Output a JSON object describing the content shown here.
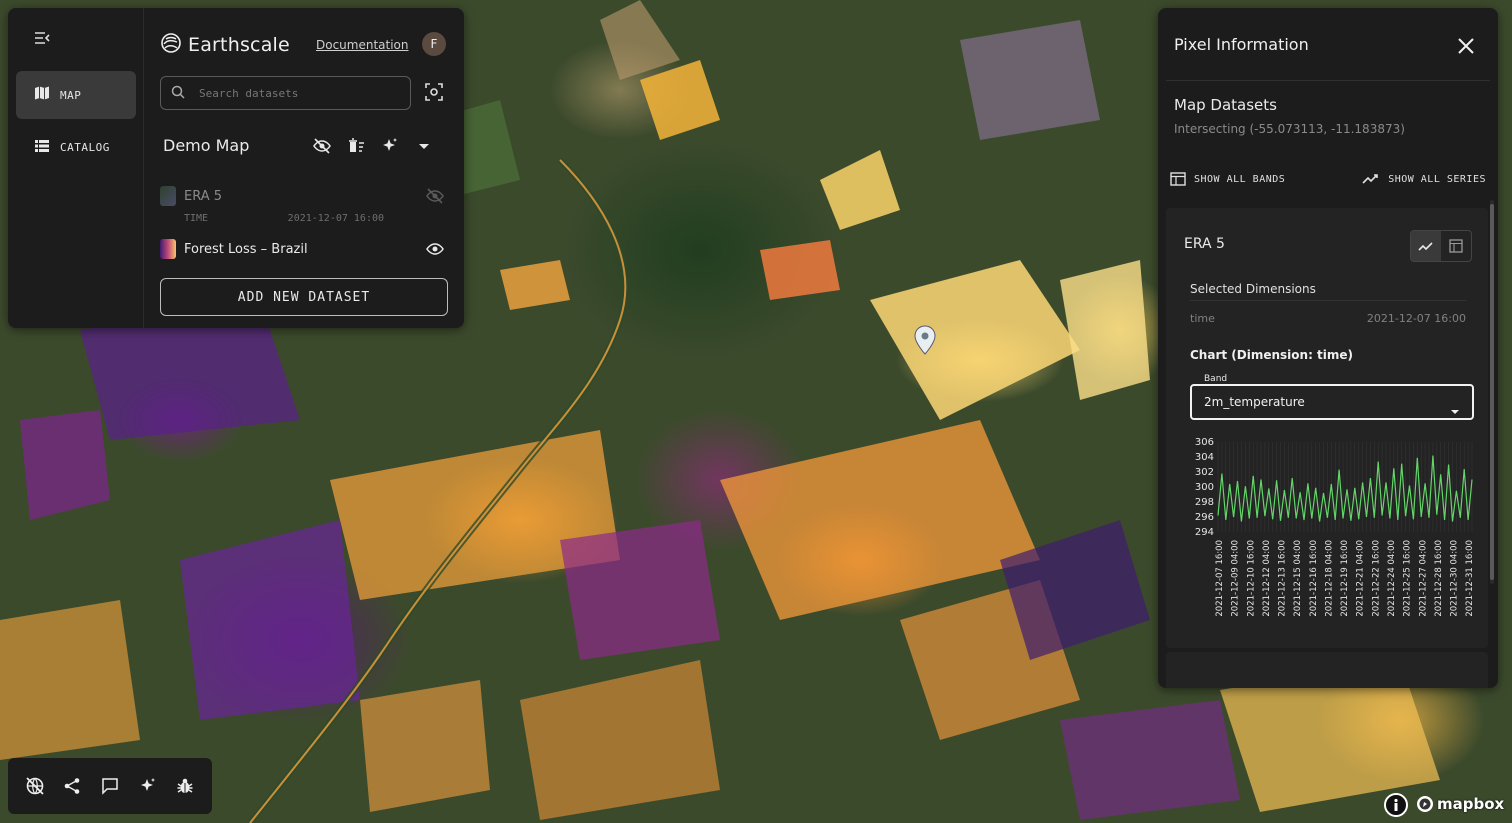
{
  "app": {
    "brand_name": "Earthscale",
    "documentation_link": "Documentation",
    "user_initial": "F"
  },
  "rail": {
    "items": [
      {
        "label": "MAP",
        "icon": "map-icon",
        "active": true
      },
      {
        "label": "CATALOG",
        "icon": "list-icon",
        "active": false
      }
    ]
  },
  "search": {
    "placeholder": "Search datasets"
  },
  "map_panel": {
    "title": "Demo Map",
    "layers": [
      {
        "name": "ERA 5",
        "visible": false,
        "dimension_label": "TIME",
        "dimension_value": "2021-12-07 16:00"
      },
      {
        "name": "Forest Loss – Brazil",
        "visible": true
      }
    ],
    "add_button": "ADD NEW DATASET"
  },
  "pixel_panel": {
    "title": "Pixel Information",
    "section_title": "Map Datasets",
    "intersecting": "Intersecting (-55.073113, -11.183873)",
    "show_all_bands": "SHOW ALL BANDS",
    "show_all_series": "SHOW ALL SERIES",
    "dataset": {
      "name": "ERA 5",
      "selected_dimensions_title": "Selected Dimensions",
      "dimension_name": "time",
      "dimension_value": "2021-12-07 16:00",
      "chart_title": "Chart (Dimension: time)",
      "band_label": "Band",
      "band_value": "2m_temperature"
    }
  },
  "colors": {
    "panel_bg": "#1c1c1c",
    "line_series": "#63d66a",
    "accent_text": "#eaeaea"
  },
  "chart_data": {
    "type": "line",
    "title": "",
    "xlabel": "",
    "ylabel": "",
    "ylim": [
      294,
      306
    ],
    "yticks": [
      "306",
      "304",
      "302",
      "300",
      "298",
      "296",
      "294"
    ],
    "xtick_labels": [
      "2021-12-07 16:00",
      "2021-12-09 04:00",
      "2021-12-10 16:00",
      "2021-12-12 04:00",
      "2021-12-13 16:00",
      "2021-12-15 04:00",
      "2021-12-16 16:00",
      "2021-12-18 04:00",
      "2021-12-19 16:00",
      "2021-12-21 04:00",
      "2021-12-22 16:00",
      "2021-12-24 04:00",
      "2021-12-25 16:00",
      "2021-12-27 04:00",
      "2021-12-28 16:00",
      "2021-12-30 04:00",
      "2021-12-31 16:00"
    ],
    "series": [
      {
        "values": [
          296.2,
          301.8,
          295.6,
          300.4,
          296.0,
          300.8,
          295.4,
          300.1,
          295.8,
          301.5,
          295.9,
          301.0,
          296.1,
          299.8,
          295.7,
          300.9,
          295.5,
          299.6,
          295.9,
          301.2,
          295.8,
          299.3,
          295.6,
          300.5,
          295.8,
          299.9,
          295.4,
          299.2,
          295.9,
          300.4,
          295.6,
          302.3,
          295.8,
          299.7,
          295.5,
          299.9,
          295.7,
          300.6,
          296.0,
          301.2,
          295.9,
          303.4,
          296.2,
          300.6,
          295.8,
          302.5,
          295.6,
          303.1,
          296.1,
          300.2,
          295.7,
          303.9,
          296.0,
          300.5,
          295.9,
          304.2,
          296.3,
          301.7,
          295.6,
          303.0,
          295.4,
          299.5,
          295.9,
          302.4,
          295.6,
          301.0
        ]
      }
    ]
  }
}
